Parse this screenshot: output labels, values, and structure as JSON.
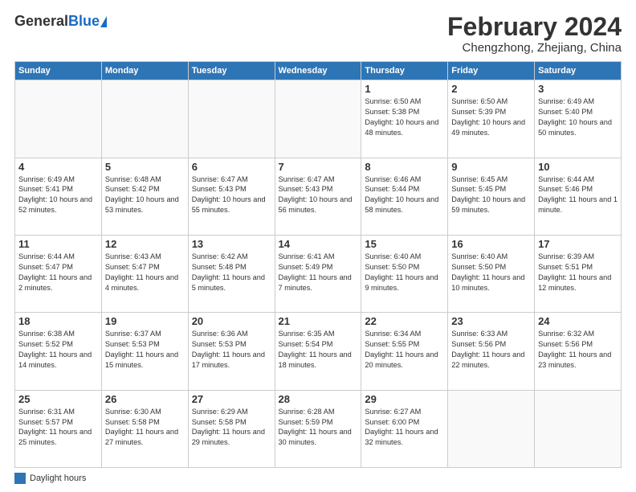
{
  "header": {
    "logo_general": "General",
    "logo_blue": "Blue",
    "month_title": "February 2024",
    "location": "Chengzhong, Zhejiang, China"
  },
  "days_of_week": [
    "Sunday",
    "Monday",
    "Tuesday",
    "Wednesday",
    "Thursday",
    "Friday",
    "Saturday"
  ],
  "legend_label": "Daylight hours",
  "weeks": [
    [
      {
        "day": "",
        "info": ""
      },
      {
        "day": "",
        "info": ""
      },
      {
        "day": "",
        "info": ""
      },
      {
        "day": "",
        "info": ""
      },
      {
        "day": "1",
        "info": "Sunrise: 6:50 AM\nSunset: 5:38 PM\nDaylight: 10 hours and 48 minutes."
      },
      {
        "day": "2",
        "info": "Sunrise: 6:50 AM\nSunset: 5:39 PM\nDaylight: 10 hours and 49 minutes."
      },
      {
        "day": "3",
        "info": "Sunrise: 6:49 AM\nSunset: 5:40 PM\nDaylight: 10 hours and 50 minutes."
      }
    ],
    [
      {
        "day": "4",
        "info": "Sunrise: 6:49 AM\nSunset: 5:41 PM\nDaylight: 10 hours and 52 minutes."
      },
      {
        "day": "5",
        "info": "Sunrise: 6:48 AM\nSunset: 5:42 PM\nDaylight: 10 hours and 53 minutes."
      },
      {
        "day": "6",
        "info": "Sunrise: 6:47 AM\nSunset: 5:43 PM\nDaylight: 10 hours and 55 minutes."
      },
      {
        "day": "7",
        "info": "Sunrise: 6:47 AM\nSunset: 5:43 PM\nDaylight: 10 hours and 56 minutes."
      },
      {
        "day": "8",
        "info": "Sunrise: 6:46 AM\nSunset: 5:44 PM\nDaylight: 10 hours and 58 minutes."
      },
      {
        "day": "9",
        "info": "Sunrise: 6:45 AM\nSunset: 5:45 PM\nDaylight: 10 hours and 59 minutes."
      },
      {
        "day": "10",
        "info": "Sunrise: 6:44 AM\nSunset: 5:46 PM\nDaylight: 11 hours and 1 minute."
      }
    ],
    [
      {
        "day": "11",
        "info": "Sunrise: 6:44 AM\nSunset: 5:47 PM\nDaylight: 11 hours and 2 minutes."
      },
      {
        "day": "12",
        "info": "Sunrise: 6:43 AM\nSunset: 5:47 PM\nDaylight: 11 hours and 4 minutes."
      },
      {
        "day": "13",
        "info": "Sunrise: 6:42 AM\nSunset: 5:48 PM\nDaylight: 11 hours and 5 minutes."
      },
      {
        "day": "14",
        "info": "Sunrise: 6:41 AM\nSunset: 5:49 PM\nDaylight: 11 hours and 7 minutes."
      },
      {
        "day": "15",
        "info": "Sunrise: 6:40 AM\nSunset: 5:50 PM\nDaylight: 11 hours and 9 minutes."
      },
      {
        "day": "16",
        "info": "Sunrise: 6:40 AM\nSunset: 5:50 PM\nDaylight: 11 hours and 10 minutes."
      },
      {
        "day": "17",
        "info": "Sunrise: 6:39 AM\nSunset: 5:51 PM\nDaylight: 11 hours and 12 minutes."
      }
    ],
    [
      {
        "day": "18",
        "info": "Sunrise: 6:38 AM\nSunset: 5:52 PM\nDaylight: 11 hours and 14 minutes."
      },
      {
        "day": "19",
        "info": "Sunrise: 6:37 AM\nSunset: 5:53 PM\nDaylight: 11 hours and 15 minutes."
      },
      {
        "day": "20",
        "info": "Sunrise: 6:36 AM\nSunset: 5:53 PM\nDaylight: 11 hours and 17 minutes."
      },
      {
        "day": "21",
        "info": "Sunrise: 6:35 AM\nSunset: 5:54 PM\nDaylight: 11 hours and 18 minutes."
      },
      {
        "day": "22",
        "info": "Sunrise: 6:34 AM\nSunset: 5:55 PM\nDaylight: 11 hours and 20 minutes."
      },
      {
        "day": "23",
        "info": "Sunrise: 6:33 AM\nSunset: 5:56 PM\nDaylight: 11 hours and 22 minutes."
      },
      {
        "day": "24",
        "info": "Sunrise: 6:32 AM\nSunset: 5:56 PM\nDaylight: 11 hours and 23 minutes."
      }
    ],
    [
      {
        "day": "25",
        "info": "Sunrise: 6:31 AM\nSunset: 5:57 PM\nDaylight: 11 hours and 25 minutes."
      },
      {
        "day": "26",
        "info": "Sunrise: 6:30 AM\nSunset: 5:58 PM\nDaylight: 11 hours and 27 minutes."
      },
      {
        "day": "27",
        "info": "Sunrise: 6:29 AM\nSunset: 5:58 PM\nDaylight: 11 hours and 29 minutes."
      },
      {
        "day": "28",
        "info": "Sunrise: 6:28 AM\nSunset: 5:59 PM\nDaylight: 11 hours and 30 minutes."
      },
      {
        "day": "29",
        "info": "Sunrise: 6:27 AM\nSunset: 6:00 PM\nDaylight: 11 hours and 32 minutes."
      },
      {
        "day": "",
        "info": ""
      },
      {
        "day": "",
        "info": ""
      }
    ]
  ]
}
